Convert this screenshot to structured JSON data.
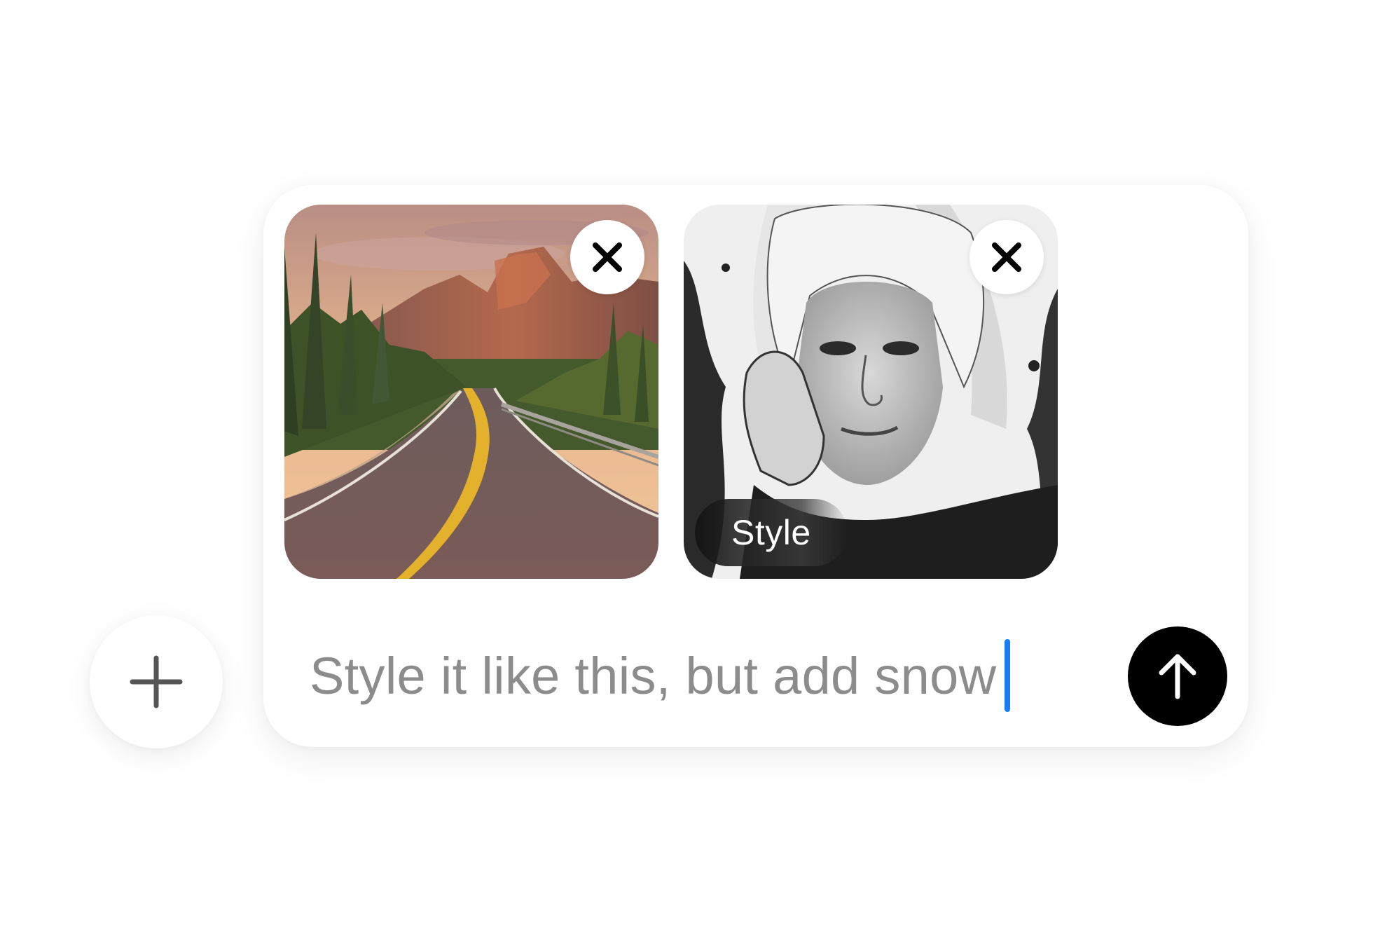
{
  "composer": {
    "attachments": [
      {
        "kind": "image",
        "subject": "winding mountain road at sunset",
        "remove_icon": "close-icon"
      },
      {
        "kind": "image",
        "subject": "ink sketch portrait",
        "badge_label": "Style",
        "remove_icon": "close-icon"
      }
    ],
    "prompt_text": "Style it like this, but add snow",
    "add_icon": "plus-icon",
    "send_icon": "arrow-up-icon"
  },
  "colors": {
    "caret": "#1a7cf2",
    "send_button": "#000000",
    "placeholder_text": "#8c8c8c",
    "background": "#ffffff"
  }
}
